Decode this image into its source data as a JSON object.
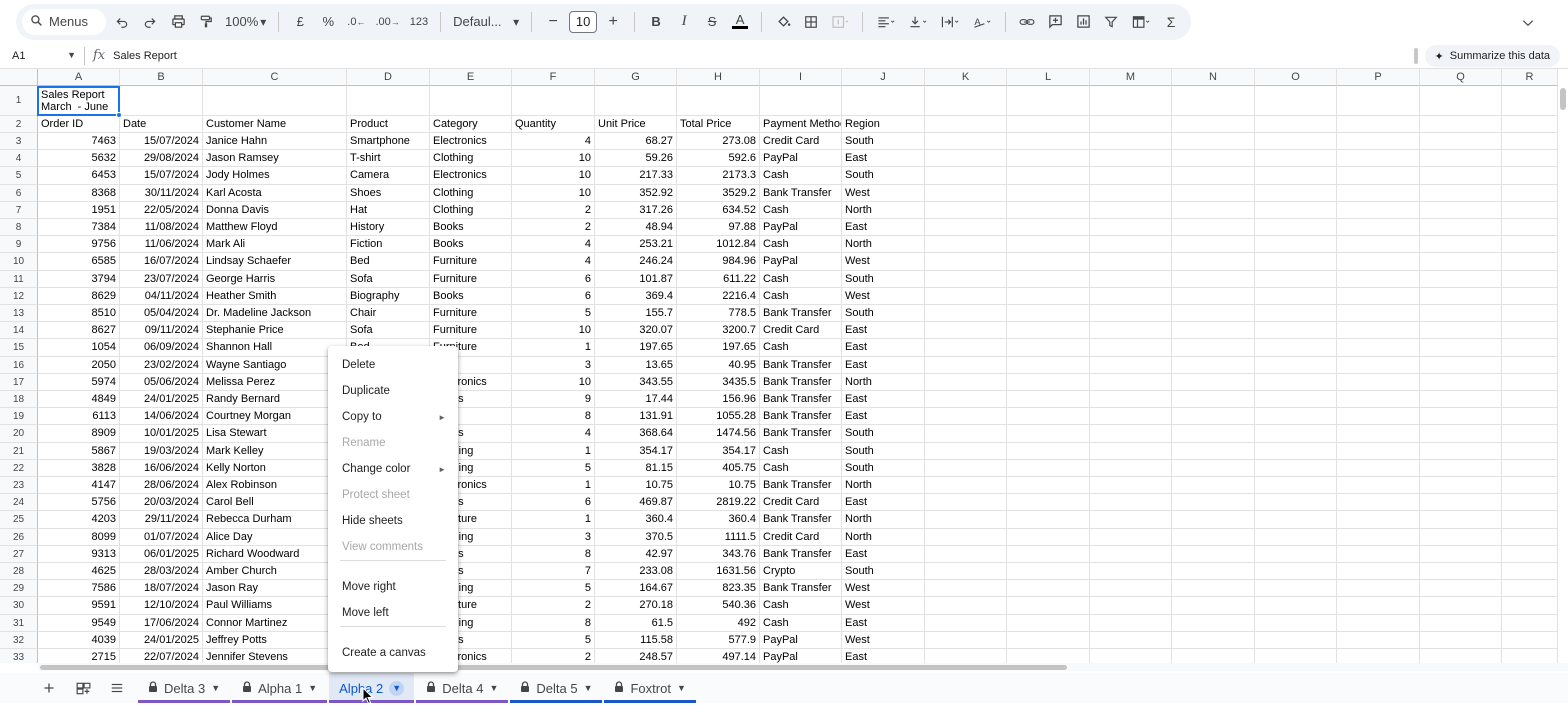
{
  "toolbar": {
    "menus_label": "Menus",
    "zoom": "100%",
    "currency": "£",
    "percent": "%",
    "dec_decrease": ".0",
    "dec_increase": ".00",
    "number_format": "123",
    "font_name": "Defaul...",
    "font_size": "10"
  },
  "formula_bar": {
    "cell_ref": "A1",
    "fx": "fx",
    "content": "Sales Report",
    "summarize_label": "Summarize this data"
  },
  "columns": [
    "A",
    "B",
    "C",
    "D",
    "E",
    "F",
    "G",
    "H",
    "I",
    "J",
    "K",
    "L",
    "M",
    "N",
    "O",
    "P",
    "Q",
    "R"
  ],
  "title_cell": "Sales Report\nMarch  - June",
  "headers": [
    "Order ID",
    "Date",
    "Customer Name",
    "Product",
    "Category",
    "Quantity",
    "Unit Price",
    "Total Price",
    "Payment Method",
    "Region"
  ],
  "rows": [
    [
      "7463",
      "15/07/2024",
      "Janice Hahn",
      "Smartphone",
      "Electronics",
      "4",
      "68.27",
      "273.08",
      "Credit Card",
      "South"
    ],
    [
      "5632",
      "29/08/2024",
      "Jason Ramsey",
      "T-shirt",
      "Clothing",
      "10",
      "59.26",
      "592.6",
      "PayPal",
      "East"
    ],
    [
      "6453",
      "15/07/2024",
      "Jody Holmes",
      "Camera",
      "Electronics",
      "10",
      "217.33",
      "2173.3",
      "Cash",
      "South"
    ],
    [
      "8368",
      "30/11/2024",
      "Karl Acosta",
      "Shoes",
      "Clothing",
      "10",
      "352.92",
      "3529.2",
      "Bank Transfer",
      "West"
    ],
    [
      "1951",
      "22/05/2024",
      "Donna Davis",
      "Hat",
      "Clothing",
      "2",
      "317.26",
      "634.52",
      "Cash",
      "North"
    ],
    [
      "7384",
      "11/08/2024",
      "Matthew Floyd",
      "History",
      "Books",
      "2",
      "48.94",
      "97.88",
      "PayPal",
      "East"
    ],
    [
      "9756",
      "11/06/2024",
      "Mark Ali",
      "Fiction",
      "Books",
      "4",
      "253.21",
      "1012.84",
      "Cash",
      "North"
    ],
    [
      "6585",
      "16/07/2024",
      "Lindsay Schaefer",
      "Bed",
      "Furniture",
      "4",
      "246.24",
      "984.96",
      "PayPal",
      "West"
    ],
    [
      "3794",
      "23/07/2024",
      "George Harris",
      "Sofa",
      "Furniture",
      "6",
      "101.87",
      "611.22",
      "Cash",
      "South"
    ],
    [
      "8629",
      "04/11/2024",
      "Heather Smith",
      "Biography",
      "Books",
      "6",
      "369.4",
      "2216.4",
      "Cash",
      "West"
    ],
    [
      "8510",
      "05/04/2024",
      "Dr. Madeline Jackson",
      "Chair",
      "Furniture",
      "5",
      "155.7",
      "778.5",
      "Bank Transfer",
      "South"
    ],
    [
      "8627",
      "09/11/2024",
      "Stephanie Price",
      "Sofa",
      "Furniture",
      "10",
      "320.07",
      "3200.7",
      "Credit Card",
      "East"
    ],
    [
      "1054",
      "06/09/2024",
      "Shannon Hall",
      "Bed",
      "Furniture",
      "1",
      "197.65",
      "197.65",
      "Cash",
      "East"
    ],
    [
      "2050",
      "23/02/2024",
      "Wayne Santiago",
      "",
      "",
      "3",
      "13.65",
      "40.95",
      "Bank Transfer",
      "East"
    ],
    [
      "5974",
      "05/06/2024",
      "Melissa Perez",
      "",
      "Electronics",
      "10",
      "343.55",
      "3435.5",
      "Bank Transfer",
      "North"
    ],
    [
      "4849",
      "24/01/2025",
      "Randy Bernard",
      "",
      "Books",
      "9",
      "17.44",
      "156.96",
      "Bank Transfer",
      "East"
    ],
    [
      "6113",
      "14/06/2024",
      "Courtney Morgan",
      "",
      "",
      "8",
      "131.91",
      "1055.28",
      "Bank Transfer",
      "East"
    ],
    [
      "8909",
      "10/01/2025",
      "Lisa Stewart",
      "",
      "Books",
      "4",
      "368.64",
      "1474.56",
      "Bank Transfer",
      "South"
    ],
    [
      "5867",
      "19/03/2024",
      "Mark Kelley",
      "",
      "Clothing",
      "1",
      "354.17",
      "354.17",
      "Cash",
      "South"
    ],
    [
      "3828",
      "16/06/2024",
      "Kelly Norton",
      "",
      "Clothing",
      "5",
      "81.15",
      "405.75",
      "Cash",
      "South"
    ],
    [
      "4147",
      "28/06/2024",
      "Alex Robinson",
      "",
      "Electronics",
      "1",
      "10.75",
      "10.75",
      "Bank Transfer",
      "North"
    ],
    [
      "5756",
      "20/03/2024",
      "Carol Bell",
      "",
      "Books",
      "6",
      "469.87",
      "2819.22",
      "Credit Card",
      "East"
    ],
    [
      "4203",
      "29/11/2024",
      "Rebecca Durham",
      "",
      "Furniture",
      "1",
      "360.4",
      "360.4",
      "Bank Transfer",
      "North"
    ],
    [
      "8099",
      "01/07/2024",
      "Alice Day",
      "",
      "Clothing",
      "3",
      "370.5",
      "1111.5",
      "Credit Card",
      "North"
    ],
    [
      "9313",
      "06/01/2025",
      "Richard Woodward",
      "",
      "Books",
      "8",
      "42.97",
      "343.76",
      "Bank Transfer",
      "East"
    ],
    [
      "4625",
      "28/03/2024",
      "Amber Church",
      "",
      "Books",
      "7",
      "233.08",
      "1631.56",
      "Crypto",
      "South"
    ],
    [
      "7586",
      "18/07/2024",
      "Jason Ray",
      "",
      "Clothing",
      "5",
      "164.67",
      "823.35",
      "Bank Transfer",
      "West"
    ],
    [
      "9591",
      "12/10/2024",
      "Paul Williams",
      "",
      "Furniture",
      "2",
      "270.18",
      "540.36",
      "Cash",
      "West"
    ],
    [
      "9549",
      "17/06/2024",
      "Connor Martinez",
      "",
      "Clothing",
      "8",
      "61.5",
      "492",
      "Cash",
      "East"
    ],
    [
      "4039",
      "24/01/2025",
      "Jeffrey Potts",
      "",
      "Books",
      "5",
      "115.58",
      "577.9",
      "PayPal",
      "West"
    ],
    [
      "2715",
      "22/07/2024",
      "Jennifer Stevens",
      "",
      "Electronics",
      "2",
      "248.57",
      "497.14",
      "PayPal",
      "East"
    ]
  ],
  "context_menu": [
    {
      "label": "Delete",
      "disabled": false
    },
    {
      "label": "Duplicate",
      "disabled": false
    },
    {
      "label": "Copy to",
      "disabled": false,
      "submenu": true
    },
    {
      "label": "Rename",
      "disabled": true
    },
    {
      "label": "Change color",
      "disabled": false,
      "submenu": true
    },
    {
      "label": "Protect sheet",
      "disabled": true
    },
    {
      "label": "Hide sheets",
      "disabled": false
    },
    {
      "label": "View comments",
      "disabled": true
    },
    {
      "label": "Move right",
      "disabled": false
    },
    {
      "label": "Move left",
      "disabled": false
    },
    {
      "label": "Create a canvas",
      "disabled": false
    }
  ],
  "sheets": [
    {
      "name": "Delta 3",
      "color": "#7e57c2",
      "locked": true,
      "active": false
    },
    {
      "name": "Alpha 1",
      "color": "#7e57c2",
      "locked": true,
      "active": false
    },
    {
      "name": "Alpha 2",
      "color": "#7e57c2",
      "locked": false,
      "active": true
    },
    {
      "name": "Delta 4",
      "color": "#7e57c2",
      "locked": true,
      "active": false
    },
    {
      "name": "Delta 5",
      "color": "#1a56c7",
      "locked": true,
      "active": false
    },
    {
      "name": "Foxtrot",
      "color": "#1a56c7",
      "locked": true,
      "active": false
    }
  ],
  "colors": {
    "selection": "#1a73e8",
    "active_tab_bg": "#e1e9f7",
    "active_tab_text": "#0b57d0"
  }
}
